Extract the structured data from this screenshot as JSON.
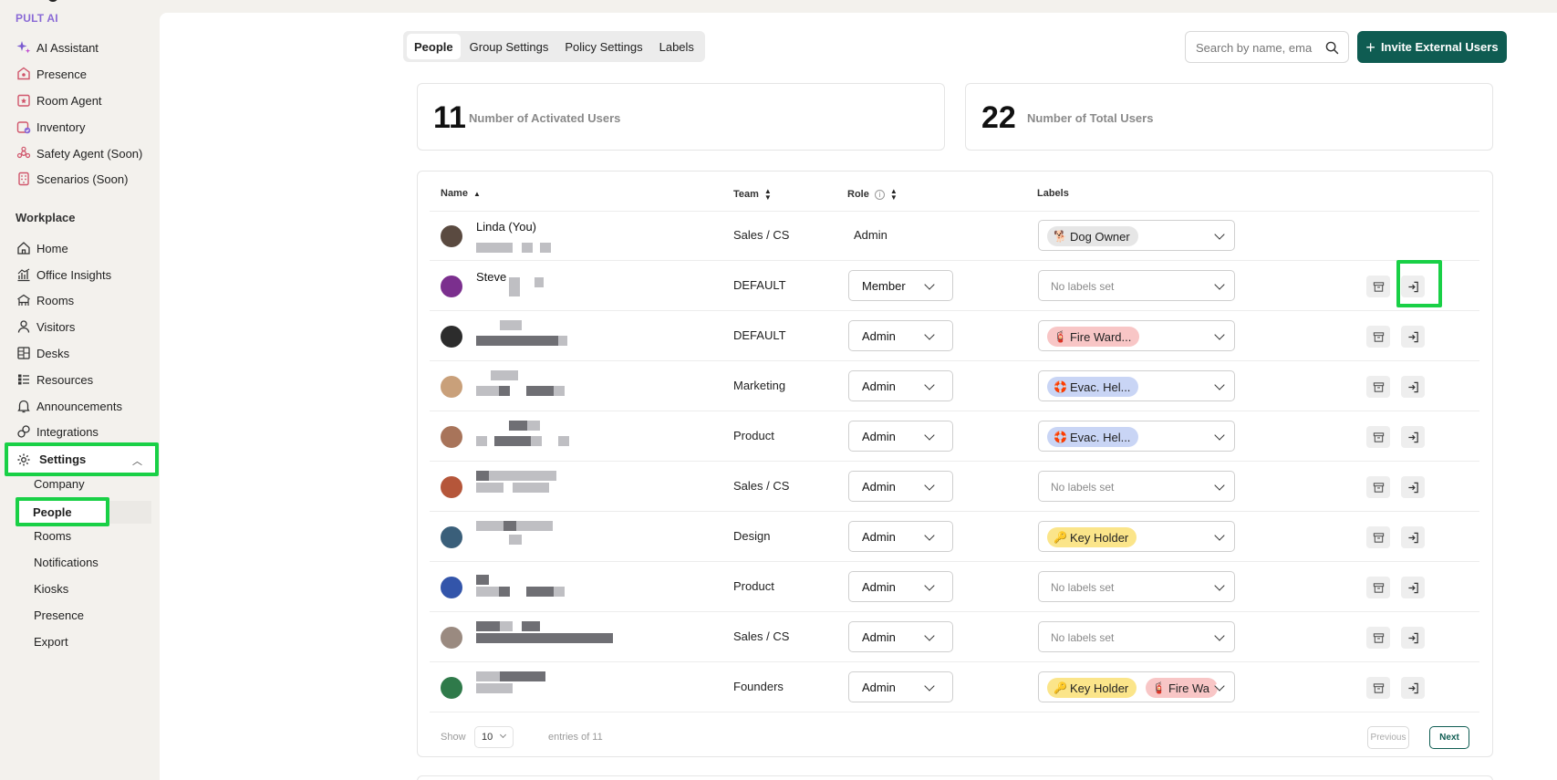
{
  "brand": "PULT AI",
  "colors": {
    "accent": "#0f5c52",
    "highlight": "#19d046",
    "brand": "#8a6ad6"
  },
  "sidebar": {
    "apps": [
      {
        "label": "AI Assistant",
        "icon": "sparkle-icon"
      },
      {
        "label": "Presence",
        "icon": "presence-icon"
      },
      {
        "label": "Room Agent",
        "icon": "room-agent-icon"
      },
      {
        "label": "Inventory",
        "icon": "inventory-icon"
      },
      {
        "label": "Safety Agent (Soon)",
        "icon": "safety-icon"
      },
      {
        "label": "Scenarios (Soon)",
        "icon": "scenarios-icon"
      }
    ],
    "workplace_title": "Workplace",
    "workplace": [
      {
        "label": "Home",
        "icon": "home-icon"
      },
      {
        "label": "Office Insights",
        "icon": "chart-icon"
      },
      {
        "label": "Rooms",
        "icon": "rooms-icon"
      },
      {
        "label": "Visitors",
        "icon": "user-icon"
      },
      {
        "label": "Desks",
        "icon": "desk-icon"
      },
      {
        "label": "Resources",
        "icon": "resources-icon"
      },
      {
        "label": "Announcements",
        "icon": "bell-icon"
      },
      {
        "label": "Integrations",
        "icon": "link-icon"
      }
    ],
    "settings_label": "Settings",
    "settings_sub": [
      "Company",
      "People",
      "Rooms",
      "Notifications",
      "Kiosks",
      "Presence",
      "Export"
    ]
  },
  "tabs": [
    "People",
    "Group Settings",
    "Policy Settings",
    "Labels"
  ],
  "search_placeholder": "Search by name, ema",
  "invite_label": "Invite External Users",
  "stats": [
    {
      "value": "11",
      "label": "Number of Activated Users"
    },
    {
      "value": "22",
      "label": "Number of Total Users"
    }
  ],
  "table": {
    "headers": {
      "name": "Name",
      "team": "Team",
      "role": "Role",
      "labels": "Labels"
    },
    "rows": [
      {
        "name": "Linda (You)",
        "team": "Sales / CS",
        "role": "Admin",
        "role_editable": false,
        "labels": [
          {
            "text": "Dog Owner",
            "emoji": "🐕",
            "color": "gray"
          }
        ],
        "actions": false
      },
      {
        "name": "Steve",
        "team": "DEFAULT",
        "role": "Member",
        "role_editable": true,
        "labels": [],
        "actions": true
      },
      {
        "name": "",
        "team": "DEFAULT",
        "role": "Admin",
        "role_editable": true,
        "labels": [
          {
            "text": "Fire Ward...",
            "emoji": "🧯",
            "color": "red"
          }
        ],
        "actions": true
      },
      {
        "name": "",
        "team": "Marketing",
        "role": "Admin",
        "role_editable": true,
        "labels": [
          {
            "text": "Evac. Hel...",
            "emoji": "🛟",
            "color": "blue"
          }
        ],
        "actions": true
      },
      {
        "name": "",
        "team": "Product",
        "role": "Admin",
        "role_editable": true,
        "labels": [
          {
            "text": "Evac. Hel...",
            "emoji": "🛟",
            "color": "blue"
          }
        ],
        "actions": true
      },
      {
        "name": "",
        "team": "Sales / CS",
        "role": "Admin",
        "role_editable": true,
        "labels": [],
        "actions": true
      },
      {
        "name": "",
        "team": "Design",
        "role": "Admin",
        "role_editable": true,
        "labels": [
          {
            "text": "Key Holder",
            "emoji": "🔑",
            "color": "yellow"
          }
        ],
        "actions": true
      },
      {
        "name": "",
        "team": "Product",
        "role": "Admin",
        "role_editable": true,
        "labels": [],
        "actions": true
      },
      {
        "name": "",
        "team": "Sales / CS",
        "role": "Admin",
        "role_editable": true,
        "labels": [],
        "actions": true
      },
      {
        "name": "",
        "team": "Founders",
        "role": "Admin",
        "role_editable": true,
        "labels": [
          {
            "text": "Key Holder",
            "emoji": "🔑",
            "color": "yellow"
          },
          {
            "text": "Fire Wa",
            "emoji": "🧯",
            "color": "red"
          }
        ],
        "actions": true
      }
    ],
    "no_labels_text": "No labels set"
  },
  "footer": {
    "show": "Show",
    "page_size": "10",
    "entries": "entries of 11",
    "previous": "Previous",
    "next": "Next"
  }
}
